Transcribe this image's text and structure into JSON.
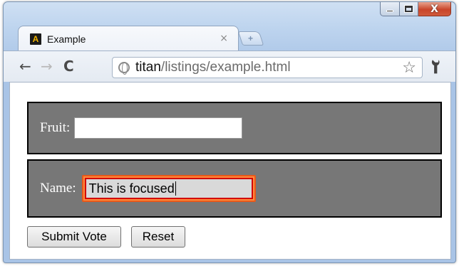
{
  "tab": {
    "title": "Example",
    "favicon_letter": "A",
    "close_glyph": "×",
    "newtab_glyph": "+"
  },
  "window_controls": {
    "minimize": "minimize-icon",
    "maximize": "maximize-icon",
    "close_glyph": "X"
  },
  "toolbar": {
    "back_glyph": "←",
    "forward_glyph": "→",
    "reload_glyph": "C",
    "url_host": "titan",
    "url_path": "/listings/example.html",
    "star_glyph": "☆",
    "wrench_glyph": "🔧"
  },
  "form": {
    "fruit_label": "Fruit:",
    "fruit_value": "",
    "name_label": "Name:",
    "name_value": "This is focused",
    "submit_label": "Submit Vote",
    "reset_label": "Reset"
  },
  "colors": {
    "panel_background": "#777777",
    "focus_outline": "#d20000",
    "focus_ring": "#ff8a3c"
  }
}
